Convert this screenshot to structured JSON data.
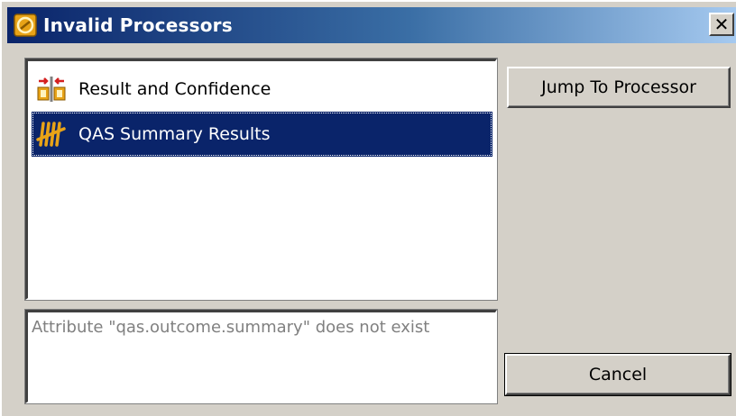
{
  "window": {
    "title": "Invalid Processors",
    "close_label": "✕"
  },
  "processors": {
    "items": [
      {
        "label": "Result and Confidence",
        "icon": "result-confidence-icon",
        "selected": false
      },
      {
        "label": "QAS Summary Results",
        "icon": "tally-marks-icon",
        "selected": true
      }
    ]
  },
  "message": {
    "text": "Attribute \"qas.outcome.summary\" does not exist"
  },
  "buttons": {
    "jump_label": "Jump To Processor",
    "cancel_label": "Cancel"
  },
  "colors": {
    "selection": "#0a246a",
    "dialog_face": "#d4d0c8",
    "icon_gold": "#e8a317",
    "icon_red": "#d42020"
  }
}
